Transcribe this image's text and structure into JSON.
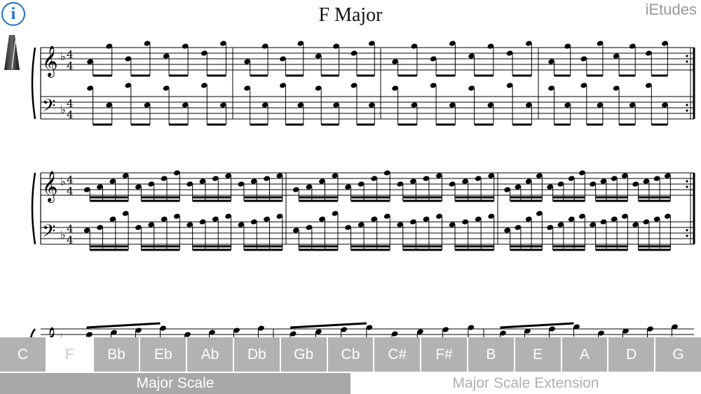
{
  "app": {
    "brand": "iEtudes"
  },
  "score": {
    "title": "F Major",
    "time_signature": {
      "top": "4",
      "bottom": "4"
    },
    "clef_glyphs": {
      "treble": "𝄞",
      "bass": "𝄢",
      "flat": "♭"
    }
  },
  "icons": {
    "info": "i",
    "metronome": "metronome-icon"
  },
  "keys": [
    {
      "label": "C",
      "selected": false
    },
    {
      "label": "F",
      "selected": true
    },
    {
      "label": "Bb",
      "selected": false
    },
    {
      "label": "Eb",
      "selected": false
    },
    {
      "label": "Ab",
      "selected": false
    },
    {
      "label": "Db",
      "selected": false
    },
    {
      "label": "Gb",
      "selected": false
    },
    {
      "label": "Cb",
      "selected": false
    },
    {
      "label": "C#",
      "selected": false
    },
    {
      "label": "F#",
      "selected": false
    },
    {
      "label": "B",
      "selected": false
    },
    {
      "label": "E",
      "selected": false
    },
    {
      "label": "A",
      "selected": false
    },
    {
      "label": "D",
      "selected": false
    },
    {
      "label": "G",
      "selected": false
    }
  ],
  "scale_tabs": [
    {
      "label": "Major Scale",
      "selected": true
    },
    {
      "label": "Major Scale Extension",
      "selected": false
    }
  ]
}
